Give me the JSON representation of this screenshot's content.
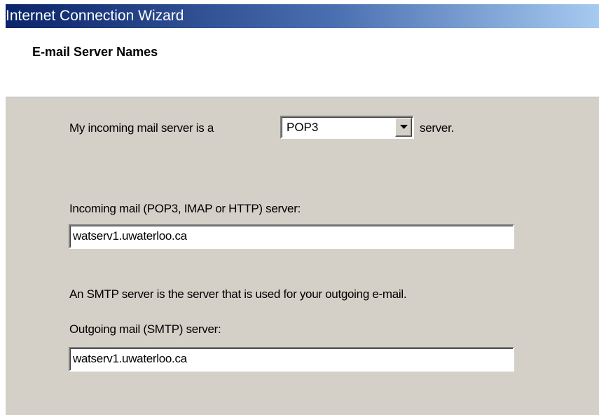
{
  "window": {
    "title": "Internet Connection Wizard"
  },
  "header": {
    "title": "E-mail Server Names"
  },
  "incoming_type": {
    "prefix": "My incoming mail server is a",
    "selected": "POP3",
    "suffix": "server."
  },
  "incoming_server": {
    "label": "Incoming mail (POP3, IMAP or HTTP) server:",
    "value": "watserv1.uwaterloo.ca"
  },
  "smtp_note": "An SMTP server is the server that is used for your outgoing e-mail.",
  "outgoing_server": {
    "label": "Outgoing mail (SMTP) server:",
    "value": "watserv1.uwaterloo.ca"
  },
  "icons": {
    "dropdown": "chevron-down-icon"
  },
  "colors": {
    "title_bar_start": "#0a246a",
    "title_bar_end": "#a6caf0",
    "dialog_face": "#d4d0c8"
  }
}
